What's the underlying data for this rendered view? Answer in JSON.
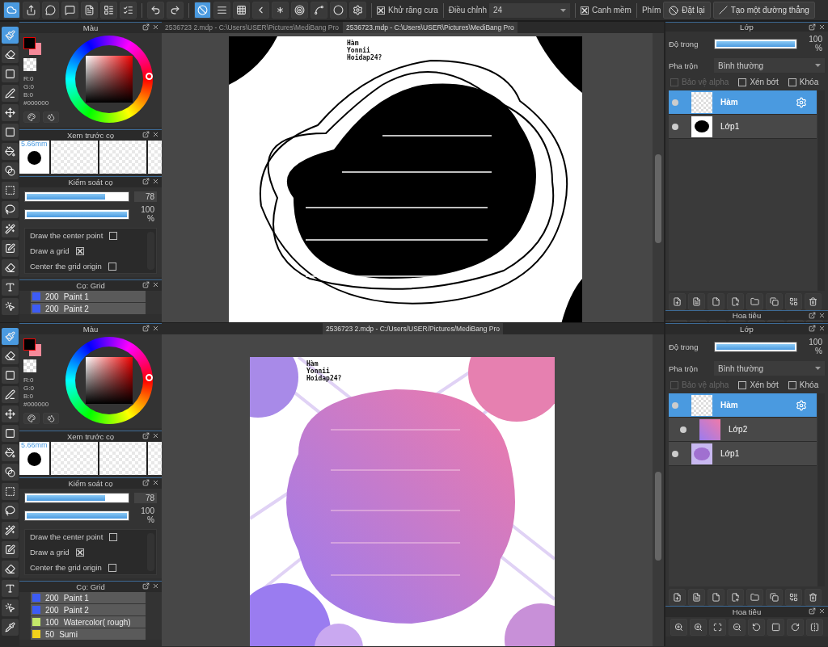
{
  "toolbar": {
    "rulers": [
      {
        "selected": true
      },
      {
        "selected": false
      },
      {
        "selected": false
      },
      {
        "selected": false
      },
      {
        "selected": false
      },
      {
        "selected": false
      },
      {
        "selected": false
      },
      {
        "selected": false
      },
      {
        "selected": false
      }
    ],
    "antialias": {
      "label": "Khử răng cưa",
      "checked": true
    },
    "adjust_label": "Điều chỉnh",
    "adjust_value": "24",
    "soft_edge": {
      "label": "Canh mềm",
      "checked": true
    },
    "keys_label": "Phím",
    "reset_button": "Đặt lại",
    "line_button": "Tạo một đường thẳng"
  },
  "screens": [
    {
      "tools": [
        {
          "selected": true
        },
        {
          "selected": false
        },
        {
          "selected": false
        },
        {
          "selected": false
        },
        {
          "selected": false
        },
        {
          "selected": false
        },
        {
          "selected": false
        },
        {
          "selected": false
        },
        {
          "selected": false
        },
        {
          "selected": false
        },
        {
          "selected": false
        },
        {
          "selected": false
        },
        {
          "selected": false
        },
        {
          "selected": false
        },
        {
          "selected": false
        }
      ],
      "color_panel": {
        "title": "Màu",
        "r": "R:0",
        "g": "G:0",
        "b": "B:0",
        "hex": "#000000"
      },
      "preview_panel": {
        "title": "Xem trước cọ",
        "size": "5.66mm"
      },
      "brush_control": {
        "title": "Kiểm soát cọ",
        "sliders": [
          {
            "level": 0.78,
            "reading": "78"
          },
          {
            "level": 1,
            "reading": "100 %"
          }
        ],
        "options": [
          {
            "label": "Draw the center point",
            "checked": false
          },
          {
            "label": "Draw a grid",
            "checked": true
          },
          {
            "label": "Center the grid origin",
            "checked": false
          }
        ]
      },
      "brush_list": {
        "title": "Cọ: Grid",
        "items": [
          {
            "size": "200",
            "name": "Paint 1",
            "color": "#3d5cf5"
          },
          {
            "size": "200",
            "name": "Paint 2",
            "color": "#3d5cf5"
          }
        ]
      },
      "tabs": [
        {
          "label": "2536723 2.mdp - C:\\Users\\USER\\Pictures\\MediBang Pro",
          "selected": false
        },
        {
          "label": "2536723.mdp - C:\\Users\\USER\\Pictures\\MediBang Pro",
          "selected": true
        }
      ],
      "canvas": {
        "kind": "mono",
        "lettering": [
          "Hàm",
          "Yonnii",
          "Hoidap24?"
        ]
      },
      "layers_panel": {
        "title": "Lớp",
        "opacity_label": "Độ trong",
        "opacity": {
          "level": 1,
          "reading": "100 %"
        },
        "blend_label": "Pha trộn",
        "blend_value": "Bình thường",
        "flags": [
          {
            "label": "Bảo vệ alpha",
            "checked": false,
            "disabled": true
          },
          {
            "label": "Xén bớt",
            "checked": false,
            "disabled": false
          },
          {
            "label": "Khóa",
            "checked": false,
            "disabled": false
          }
        ],
        "layers": [
          {
            "name": "Hàm",
            "selected": true,
            "clipped": false,
            "kind": "text"
          },
          {
            "name": "Lớp1",
            "selected": false,
            "clipped": false,
            "kind": "blob"
          }
        ]
      },
      "navigator": {
        "title": "Hoa tiêu"
      }
    },
    {
      "tools": [
        {
          "selected": true
        },
        {
          "selected": false
        },
        {
          "selected": false
        },
        {
          "selected": false
        },
        {
          "selected": false
        },
        {
          "selected": false
        },
        {
          "selected": false
        },
        {
          "selected": false
        },
        {
          "selected": false
        },
        {
          "selected": false
        },
        {
          "selected": false
        },
        {
          "selected": false
        },
        {
          "selected": false
        },
        {
          "selected": false
        },
        {
          "selected": false
        },
        {
          "selected": false
        }
      ],
      "color_panel": {
        "title": "Màu",
        "r": "R:0",
        "g": "G:0",
        "b": "B:0",
        "hex": "#000000"
      },
      "preview_panel": {
        "title": "Xem trước cọ",
        "size": "5.66mm"
      },
      "brush_control": {
        "title": "Kiểm soát cọ",
        "sliders": [
          {
            "level": 0.78,
            "reading": "78"
          },
          {
            "level": 1,
            "reading": "100 %"
          }
        ],
        "options": [
          {
            "label": "Draw the center point",
            "checked": false
          },
          {
            "label": "Draw a grid",
            "checked": true
          },
          {
            "label": "Center the grid origin",
            "checked": false
          }
        ]
      },
      "brush_list": {
        "title": "Cọ: Grid",
        "items": [
          {
            "size": "200",
            "name": "Paint 1",
            "color": "#3d5cf5"
          },
          {
            "size": "200",
            "name": "Paint 2",
            "color": "#3d5cf5"
          },
          {
            "size": "100",
            "name": "Watercolor( rough)",
            "color": "#c3e86a"
          },
          {
            "size": "50",
            "name": "Sumi",
            "color": "#f2d21b"
          }
        ]
      },
      "tabs": [
        {
          "label": "2536723 2.mdp - C:/Users/USER/Pictures/MediBang Pro",
          "selected": true
        }
      ],
      "canvas": {
        "kind": "gradient",
        "lettering": [
          "Hàm",
          "Yonnii",
          "Hoidap24?"
        ]
      },
      "layers_panel": {
        "title": "Lớp",
        "opacity_label": "Độ trong",
        "opacity": {
          "level": 1,
          "reading": "100 %"
        },
        "blend_label": "Pha trộn",
        "blend_value": "Bình thường",
        "flags": [
          {
            "label": "Bảo vệ alpha",
            "checked": false,
            "disabled": true
          },
          {
            "label": "Xén bớt",
            "checked": false,
            "disabled": false
          },
          {
            "label": "Khóa",
            "checked": false,
            "disabled": false
          }
        ],
        "layers": [
          {
            "name": "Hàm",
            "selected": true,
            "clipped": false,
            "kind": "text"
          },
          {
            "name": "Lớp2",
            "selected": false,
            "clipped": true,
            "kind": "gradient"
          },
          {
            "name": "Lớp1",
            "selected": false,
            "clipped": false,
            "kind": "purple"
          }
        ]
      },
      "navigator": {
        "title": "Hoa tiêu"
      }
    }
  ]
}
